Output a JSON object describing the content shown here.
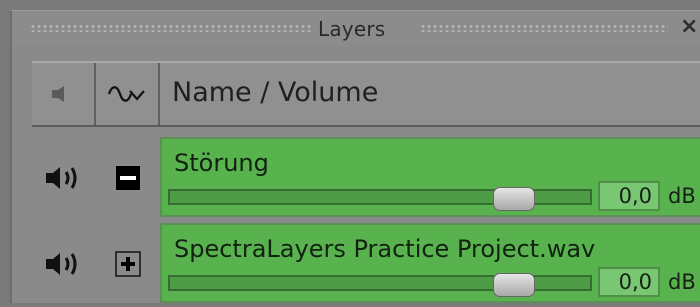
{
  "window": {
    "title": "Layers",
    "close_label": "×"
  },
  "header": {
    "speaker_icon": "speaker-icon",
    "wave_icon": "waveform-icon",
    "name_label": "Name / Volume"
  },
  "layers": [
    {
      "name": "Störung",
      "toggle_icon": "minus-icon",
      "volume_value": "0,0",
      "volume_unit": "dB",
      "slider_level": 0.82
    },
    {
      "name": "SpectraLayers Practice Project.wav",
      "toggle_icon": "plus-icon",
      "volume_value": "0,0",
      "volume_unit": "dB",
      "slider_level": 0.82
    }
  ],
  "colors": {
    "layer_bg": "#58b24e",
    "panel_bg": "#8a8a8a"
  }
}
